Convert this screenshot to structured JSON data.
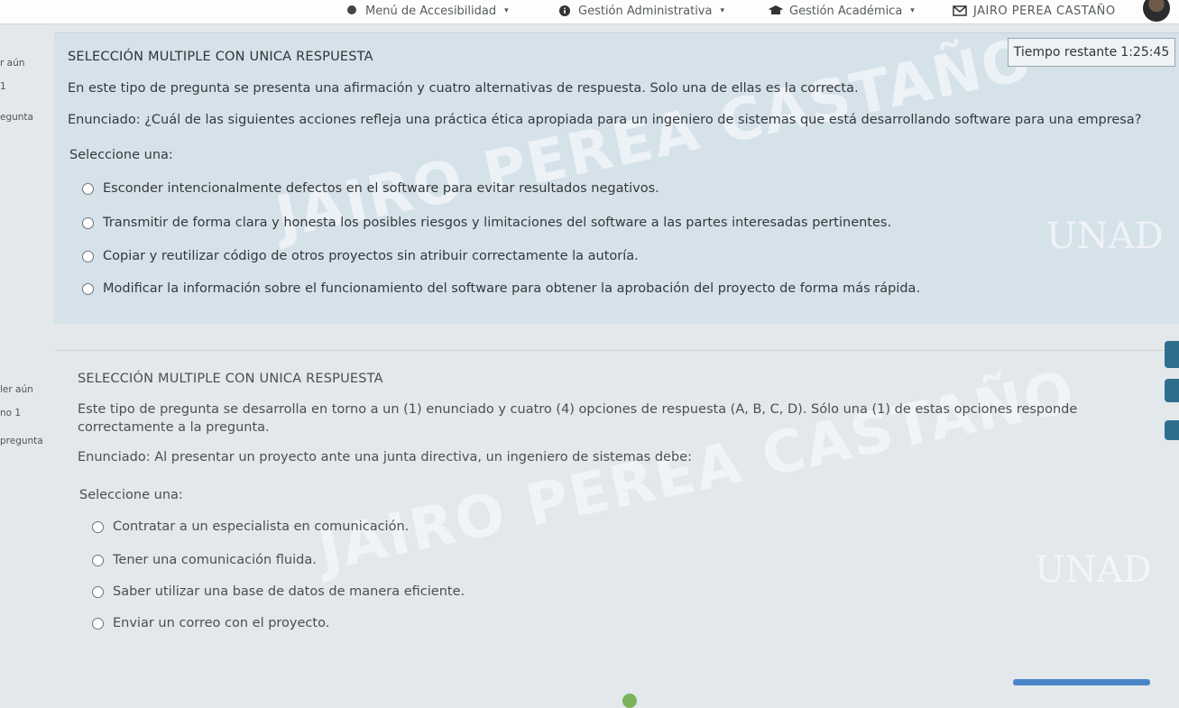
{
  "topbar": {
    "accessibility_menu": "Menú de Accesibilidad",
    "admin_menu": "Gestión Administrativa",
    "academic_menu": "Gestión Académica",
    "user_name": "JAIRO PEREA CASTAÑO"
  },
  "left_strip": {
    "q1_status": "r aún",
    "q1_number": "1",
    "q1_flag": "egunta",
    "q2_status": "ler aún",
    "q2_number": "no 1",
    "q2_flag": "pregunta"
  },
  "timer": {
    "label": "Tiempo restante",
    "value": "1:25:45"
  },
  "question1": {
    "type": "SELECCIÓN MULTIPLE CON UNICA RESPUESTA",
    "description": "En este tipo de pregunta se presenta una afirmación y cuatro alternativas de respuesta. Solo una de ellas es la correcta.",
    "statement": "Enunciado: ¿Cuál de las siguientes acciones refleja una práctica ética apropiada para un ingeniero de sistemas que está desarrollando software para una empresa?",
    "select_prompt": "Seleccione una:",
    "options": [
      "Esconder intencionalmente defectos en el software para evitar resultados negativos.",
      "Transmitir de forma clara y honesta los posibles riesgos y limitaciones del software a las partes interesadas pertinentes.",
      "Copiar y reutilizar código de otros proyectos sin atribuir correctamente la autoría.",
      "Modificar la información sobre el funcionamiento del software para obtener la aprobación del proyecto de forma más rápida."
    ]
  },
  "question2": {
    "type": "SELECCIÓN MULTIPLE CON UNICA RESPUESTA",
    "description": "Este tipo de pregunta se desarrolla en torno a un (1) enunciado y cuatro (4) opciones de respuesta (A, B, C, D). Sólo una (1) de estas opciones responde correctamente a la pregunta.",
    "statement": "Enunciado: Al presentar un proyecto ante una junta directiva, un ingeniero de sistemas debe:",
    "select_prompt": "Seleccione una:",
    "options": [
      "Contratar a un especialista en comunicación.",
      "Tener una comunicación fluida.",
      "Saber utilizar una base de datos de manera eficiente.",
      "Enviar un correo con el proyecto."
    ]
  },
  "watermark": {
    "text": "JAIRO PEREA CASTAÑO",
    "logo": "UNAD"
  },
  "colors": {
    "card_bg": "#d6e2ea",
    "page_bg": "#e4e8ea",
    "accent": "#2f6f8d",
    "progress": "#4a86c6"
  }
}
